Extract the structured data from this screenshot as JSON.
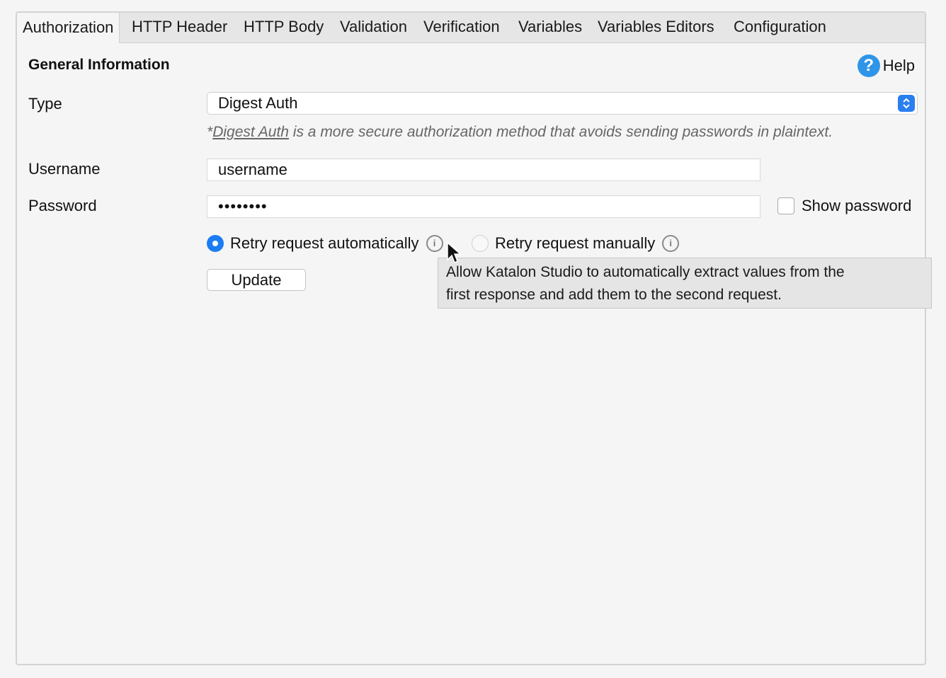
{
  "tabs": [
    {
      "label": "Authorization"
    },
    {
      "label": "HTTP Header"
    },
    {
      "label": "HTTP Body"
    },
    {
      "label": "Validation"
    },
    {
      "label": "Verification"
    },
    {
      "label": "Variables"
    },
    {
      "label": "Variables Editors"
    },
    {
      "label": "Configuration"
    }
  ],
  "section": {
    "title": "General Information",
    "help_label": "Help",
    "help_icon": "?"
  },
  "form": {
    "type_label": "Type",
    "type_value": "Digest Auth",
    "hint_prefix": "*",
    "hint_link": "Digest Auth",
    "hint_text": " is a more secure authorization method that avoids sending passwords in plaintext.",
    "username_label": "Username",
    "username_value": "username",
    "password_label": "Password",
    "password_value": "••••••••",
    "show_password_label": "Show password",
    "show_password_checked": false,
    "retry_auto_label": "Retry request automatically",
    "retry_auto_selected": true,
    "retry_manual_label": "Retry request manually",
    "info_icon": "i",
    "update_label": "Update"
  },
  "tooltip": {
    "line1": "Allow Katalon Studio to automatically extract values from the",
    "line2": "first response and add them to the second request."
  },
  "colors": {
    "accent": "#1c7cf2",
    "help": "#2f95e8"
  }
}
